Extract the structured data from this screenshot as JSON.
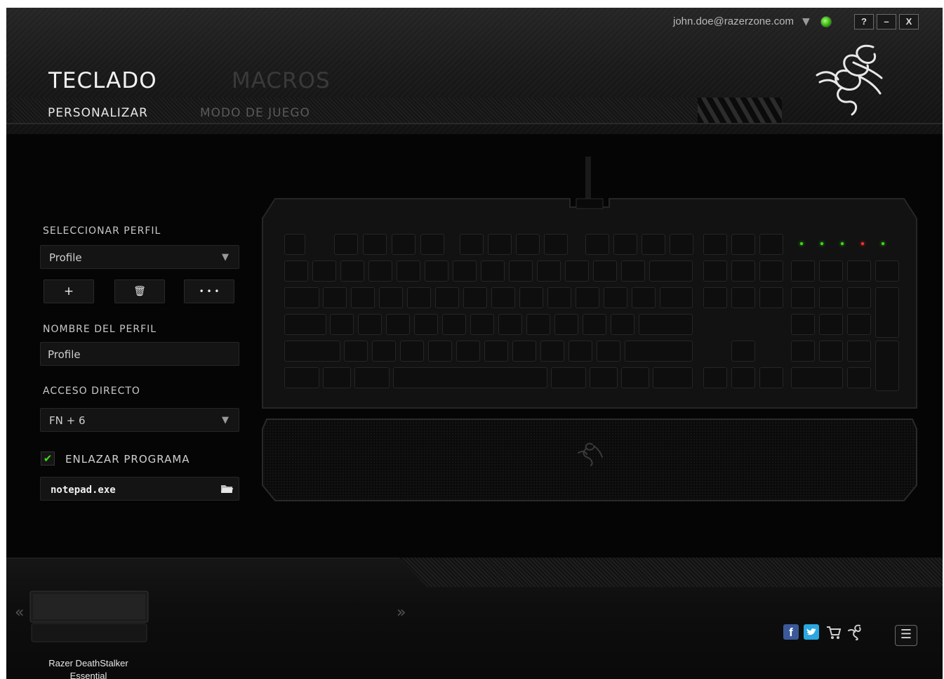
{
  "window": {
    "account_email": "john.doe@razerzone.com",
    "help_label": "?",
    "minimize_label": "–",
    "close_label": "X"
  },
  "tabs": [
    {
      "label": "TECLADO",
      "active": true
    },
    {
      "label": "MACROS",
      "active": false
    }
  ],
  "subtabs": [
    {
      "label": "PERSONALIZAR",
      "active": true
    },
    {
      "label": "MODO DE JUEGO",
      "active": false
    }
  ],
  "profile_panel": {
    "select_profile_label": "SELECCIONAR PERFIL",
    "selected_profile": "Profile",
    "add_label": "+",
    "delete_label": "🗑",
    "more_label": "• • •",
    "profile_name_label": "NOMBRE DEL PERFIL",
    "profile_name_value": "Profile",
    "shortcut_label": "ACCESO DIRECTO",
    "shortcut_value": "FN + 6",
    "link_program_label": "ENLAZAR PROGRAMA",
    "link_program_checked": true,
    "program_value": "notepad.exe"
  },
  "footer": {
    "device_name": "Razer DeathStalker Essential",
    "prev_label": "«",
    "next_label": "»",
    "menu_label": "☰"
  },
  "colors": {
    "accent_green": "#3ddc18",
    "background": "#050505",
    "facebook": "#3b5998",
    "twitter": "#2aa7e0"
  },
  "icons": [
    "status-dot-icon",
    "razer-logo-icon",
    "dropdown-caret-icon",
    "trash-icon",
    "checkmark-icon",
    "folder-icon",
    "facebook-icon",
    "twitter-icon",
    "cart-icon",
    "razer-small-icon",
    "hamburger-menu-icon"
  ]
}
